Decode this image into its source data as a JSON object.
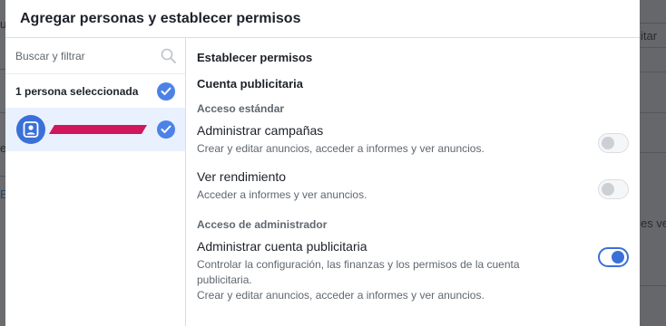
{
  "background": {
    "fragments": [
      "u",
      "e",
      "E",
      "itar",
      "es ve"
    ]
  },
  "dialog": {
    "title": "Agregar personas y establecer permisos",
    "search": {
      "placeholder": "Buscar y filtrar",
      "value": ""
    },
    "selected_label": "1 persona seleccionada",
    "people": [
      {
        "name": "",
        "selected": true
      }
    ],
    "permissions_heading": "Establecer permisos",
    "account_heading": "Cuenta publicitaria",
    "groups": [
      {
        "title": "Acceso estándar",
        "items": [
          {
            "name": "Administrar campañas",
            "description": "Crear y editar anuncios, acceder a informes y ver anuncios.",
            "enabled": false
          },
          {
            "name": "Ver rendimiento",
            "description": "Acceder a informes y ver anuncios.",
            "enabled": false
          }
        ]
      },
      {
        "title": "Acceso de administrador",
        "items": [
          {
            "name": "Administrar cuenta publicitaria",
            "description": "Controlar la configuración, las finanzas y los permisos de la cuenta publicitaria.",
            "description2": "Crear y editar anuncios, acceder a informes y ver anuncios.",
            "enabled": true
          }
        ]
      }
    ]
  },
  "colors": {
    "accent": "#3b70d9",
    "check": "#4c82e8",
    "redaction": "#d0175c",
    "selected_row": "#e9f1fe"
  },
  "icons": {
    "search": "search-icon",
    "check": "check-icon",
    "avatar": "person-icon"
  }
}
